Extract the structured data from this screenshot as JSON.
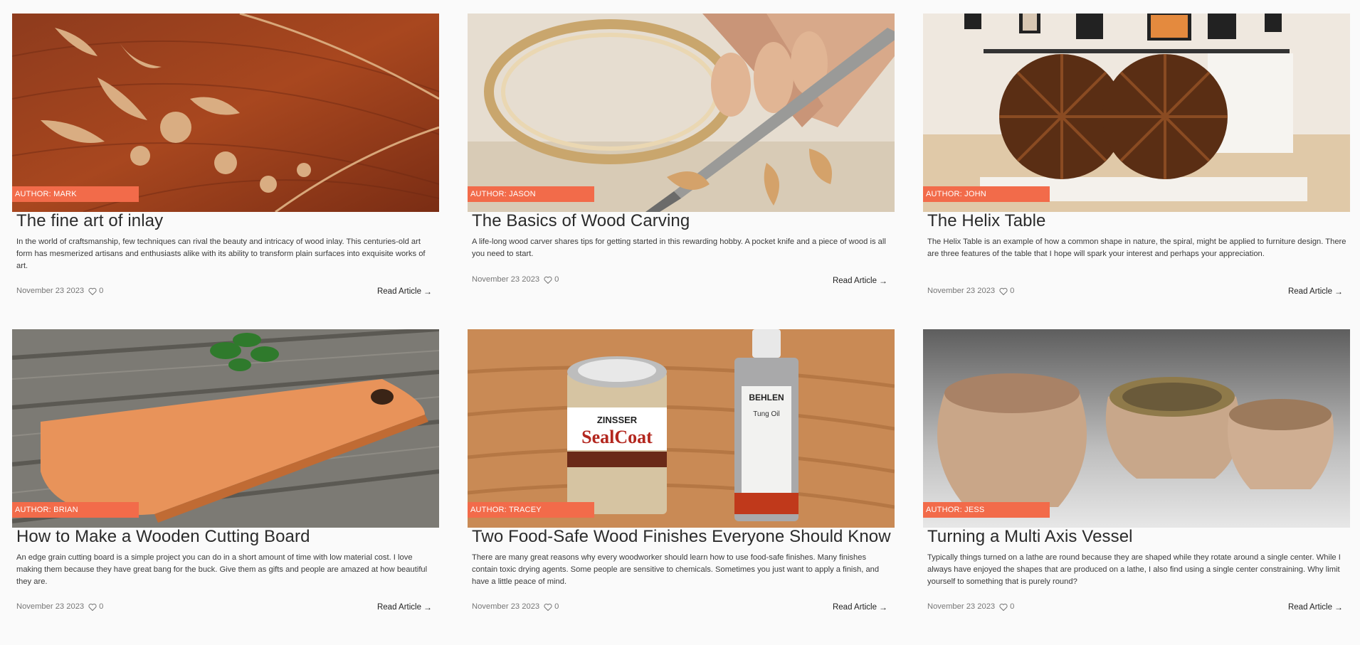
{
  "cards": [
    {
      "author": "AUTHOR: MARK",
      "title": "The fine art of inlay",
      "excerpt": "In the world of craftsmanship, few techniques can rival the beauty and intricacy of wood inlay. This centuries-old art form has mesmerized artisans and enthusiasts alike with its ability to transform plain surfaces into exquisite works of art.",
      "date": "November 23 2023",
      "likes": "0",
      "read_label": "Read Article",
      "image_icon": "inlay-photo"
    },
    {
      "author": "AUTHOR: JASON",
      "title": "The Basics of Wood Carving",
      "excerpt": "A life-long wood carver shares tips for getting started in this rewarding hobby. A pocket knife and a piece of wood is all you need to start.",
      "date": "November 23 2023",
      "likes": "0",
      "read_label": "Read Article",
      "image_icon": "carving-photo"
    },
    {
      "author": "AUTHOR: JOHN",
      "title": "The Helix Table",
      "excerpt": "The Helix Table is an example of how a common shape in nature, the spiral, might be applied to furniture design. There are three features of the table that I hope will spark your interest and perhaps your appreciation.",
      "date": "November 23 2023",
      "likes": "0",
      "read_label": "Read Article",
      "image_icon": "helix-table-photo"
    },
    {
      "author": "AUTHOR: BRIAN",
      "title": "How to Make a Wooden Cutting Board",
      "excerpt": "An edge grain cutting board is a simple project you can do in a short amount of time with low material cost. I love making them because they have great bang for the buck. Give them as gifts and people are amazed at how beautiful they are.",
      "date": "November 23 2023",
      "likes": "0",
      "read_label": "Read Article",
      "image_icon": "cutting-board-photo"
    },
    {
      "author": "AUTHOR: TRACEY",
      "title": "Two Food-Safe Wood Finishes Everyone Should Know",
      "excerpt": "There are many great reasons why every woodworker should learn how to use food-safe finishes. Many finishes contain toxic drying agents. Some people are sensitive to chemicals. Sometimes you just want to apply a finish, and have a little peace of mind.",
      "date": "November 23 2023",
      "likes": "0",
      "read_label": "Read Article",
      "image_icon": "wood-finishes-photo",
      "can_labels": {
        "brand1": "ZINSSER",
        "product1": "SealCoat",
        "brand2": "BEHLEN",
        "product2": "Tung Oil"
      }
    },
    {
      "author": "AUTHOR: JESS",
      "title": "Turning a Multi Axis Vessel",
      "excerpt": "Typically things turned on a lathe are round because they are shaped while they rotate around a single center. While I always have enjoyed the shapes that are produced on a lathe, I also find using a single center constraining. Why limit yourself to something that is purely round?",
      "date": "November 23 2023",
      "likes": "0",
      "read_label": "Read Article",
      "image_icon": "vessel-photo"
    }
  ],
  "colors": {
    "accent": "#f26b4a",
    "background": "#fafafa"
  }
}
